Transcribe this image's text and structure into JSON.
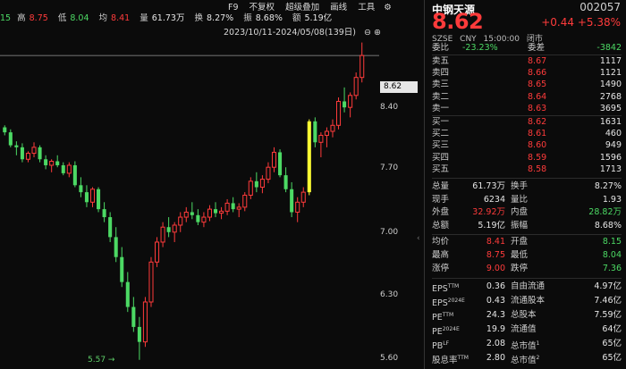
{
  "header": {
    "stats": [
      {
        "label": "15",
        "value": ""
      },
      {
        "label": "高",
        "value": "8.75"
      },
      {
        "label": "低",
        "value": "8.04"
      },
      {
        "label": "均",
        "value": "8.41"
      },
      {
        "label": "量",
        "value": "61.73万"
      },
      {
        "label": "换",
        "value": "8.27%"
      },
      {
        "label": "振",
        "value": "8.68%"
      },
      {
        "label": "额",
        "value": "5.19亿"
      }
    ],
    "menu": [
      "F9",
      "不复权",
      "超级叠加",
      "画线",
      "工具"
    ],
    "range": "2023/10/11-2024/05/08(139日)"
  },
  "chart": {
    "price_tag": "8.62",
    "low_label": "5.57",
    "y_ticks": [
      "8.40",
      "7.70",
      "7.00",
      "6.30",
      "5.60"
    ]
  },
  "chart_data": {
    "type": "candlestick",
    "y_range": [
      5.55,
      8.8
    ],
    "y_ticks": [
      8.4,
      7.7,
      7.0,
      6.3,
      5.6
    ],
    "candles": [
      [
        7.9,
        7.92,
        7.82,
        7.85
      ],
      [
        7.85,
        7.88,
        7.7,
        7.72
      ],
      [
        7.72,
        7.76,
        7.62,
        7.7
      ],
      [
        7.7,
        7.74,
        7.55,
        7.58
      ],
      [
        7.58,
        7.66,
        7.55,
        7.64
      ],
      [
        7.64,
        7.75,
        7.6,
        7.7
      ],
      [
        7.7,
        7.72,
        7.55,
        7.58
      ],
      [
        7.58,
        7.62,
        7.48,
        7.52
      ],
      [
        7.52,
        7.58,
        7.45,
        7.56
      ],
      [
        7.56,
        7.62,
        7.5,
        7.52
      ],
      [
        7.52,
        7.55,
        7.42,
        7.44
      ],
      [
        7.44,
        7.55,
        7.4,
        7.52
      ],
      [
        7.52,
        7.56,
        7.3,
        7.32
      ],
      [
        7.32,
        7.4,
        7.2,
        7.25
      ],
      [
        7.25,
        7.32,
        7.1,
        7.15
      ],
      [
        7.15,
        7.3,
        7.1,
        7.28
      ],
      [
        7.28,
        7.3,
        7.05,
        7.08
      ],
      [
        7.08,
        7.15,
        6.95,
        7.0
      ],
      [
        7.0,
        7.05,
        6.75,
        6.8
      ],
      [
        6.8,
        6.9,
        6.55,
        6.6
      ],
      [
        6.6,
        6.7,
        6.3,
        6.35
      ],
      [
        6.35,
        6.45,
        6.05,
        6.1
      ],
      [
        6.1,
        6.2,
        5.85,
        5.9
      ],
      [
        5.9,
        6.0,
        5.57,
        5.75
      ],
      [
        5.75,
        6.2,
        5.7,
        6.15
      ],
      [
        6.15,
        6.6,
        6.1,
        6.55
      ],
      [
        6.55,
        6.8,
        6.5,
        6.75
      ],
      [
        6.75,
        6.95,
        6.7,
        6.9
      ],
      [
        6.9,
        7.0,
        6.8,
        6.85
      ],
      [
        6.85,
        6.95,
        6.75,
        6.92
      ],
      [
        6.92,
        7.05,
        6.85,
        7.0
      ],
      [
        7.0,
        7.1,
        6.95,
        7.05
      ],
      [
        7.05,
        7.15,
        6.98,
        7.02
      ],
      [
        7.02,
        7.08,
        6.92,
        6.95
      ],
      [
        6.95,
        7.05,
        6.9,
        7.0
      ],
      [
        7.0,
        7.12,
        6.96,
        7.08
      ],
      [
        7.08,
        7.15,
        7.0,
        7.04
      ],
      [
        7.04,
        7.1,
        6.98,
        7.06
      ],
      [
        7.06,
        7.18,
        7.02,
        7.14
      ],
      [
        7.14,
        7.2,
        7.05,
        7.08
      ],
      [
        7.08,
        7.14,
        7.0,
        7.1
      ],
      [
        7.1,
        7.25,
        7.06,
        7.22
      ],
      [
        7.22,
        7.4,
        7.18,
        7.36
      ],
      [
        7.36,
        7.45,
        7.25,
        7.3
      ],
      [
        7.3,
        7.42,
        7.24,
        7.38
      ],
      [
        7.38,
        7.55,
        7.34,
        7.5
      ],
      [
        7.5,
        7.7,
        7.45,
        7.65
      ],
      [
        7.65,
        7.68,
        7.4,
        7.42
      ],
      [
        7.42,
        7.5,
        7.25,
        7.28
      ],
      [
        7.28,
        7.35,
        7.0,
        7.05
      ],
      [
        7.05,
        7.2,
        6.95,
        7.15
      ],
      [
        7.15,
        7.3,
        7.1,
        7.25
      ],
      [
        7.25,
        7.98,
        7.22,
        7.96
      ],
      [
        7.96,
        8.0,
        7.7,
        7.75
      ],
      [
        7.75,
        7.85,
        7.6,
        7.82
      ],
      [
        7.82,
        7.9,
        7.7,
        7.86
      ],
      [
        7.86,
        7.98,
        7.8,
        7.92
      ],
      [
        7.92,
        8.2,
        7.88,
        8.16
      ],
      [
        8.16,
        8.3,
        8.05,
        8.1
      ],
      [
        8.1,
        8.25,
        8.0,
        8.22
      ],
      [
        8.22,
        8.45,
        8.18,
        8.4
      ],
      [
        8.4,
        8.75,
        8.35,
        8.62
      ]
    ]
  },
  "quote": {
    "name": "中钢天源",
    "code": "002057",
    "price": "8.62",
    "change": "+0.44",
    "change_pct": "+5.38%",
    "exchange": "SZSE",
    "currency": "CNY",
    "time": "15:00:00",
    "status": "闭市",
    "ratio_label": "委比",
    "ratio_value": "-23.23%",
    "diff_label": "委差",
    "diff_value": "-3842"
  },
  "asks": [
    {
      "label": "卖五",
      "price": "8.67",
      "vol": "1117"
    },
    {
      "label": "卖四",
      "price": "8.66",
      "vol": "1121"
    },
    {
      "label": "卖三",
      "price": "8.65",
      "vol": "1490"
    },
    {
      "label": "卖二",
      "price": "8.64",
      "vol": "2768"
    },
    {
      "label": "卖一",
      "price": "8.63",
      "vol": "3695"
    }
  ],
  "bids": [
    {
      "label": "买一",
      "price": "8.62",
      "vol": "1631"
    },
    {
      "label": "买二",
      "price": "8.61",
      "vol": "460"
    },
    {
      "label": "买三",
      "price": "8.60",
      "vol": "949"
    },
    {
      "label": "买四",
      "price": "8.59",
      "vol": "1596"
    },
    {
      "label": "买五",
      "price": "8.58",
      "vol": "1713"
    }
  ],
  "stats_a": [
    {
      "l1": "总量",
      "v1": "61.73万",
      "c1": "white",
      "l2": "换手",
      "v2": "8.27%",
      "c2": "white"
    },
    {
      "l1": "现手",
      "v1": "6234",
      "c1": "white",
      "l2": "量比",
      "v2": "1.93",
      "c2": "white"
    },
    {
      "l1": "外盘",
      "v1": "32.92万",
      "c1": "red",
      "l2": "内盘",
      "v2": "28.82万",
      "c2": "green"
    },
    {
      "l1": "总额",
      "v1": "5.19亿",
      "c1": "white",
      "l2": "振幅",
      "v2": "8.68%",
      "c2": "white"
    }
  ],
  "stats_b": [
    {
      "l1": "均价",
      "v1": "8.41",
      "c1": "red",
      "l2": "开盘",
      "v2": "8.15",
      "c2": "green"
    },
    {
      "l1": "最高",
      "v1": "8.75",
      "c1": "red",
      "l2": "最低",
      "v2": "8.04",
      "c2": "green"
    },
    {
      "l1": "涨停",
      "v1": "9.00",
      "c1": "red",
      "l2": "跌停",
      "v2": "7.36",
      "c2": "green"
    }
  ],
  "stats_c": [
    {
      "l1": "EPS",
      "s1": "TTM",
      "v1": "0.36",
      "l2": "自由流通",
      "s2": "",
      "v2": "4.97亿"
    },
    {
      "l1": "EPS",
      "s1": "2024E",
      "v1": "0.43",
      "l2": "流通股本",
      "s2": "",
      "v2": "7.46亿"
    },
    {
      "l1": "PE",
      "s1": "TTM",
      "v1": "24.3",
      "l2": "总股本",
      "s2": "",
      "v2": "7.59亿"
    },
    {
      "l1": "PE",
      "s1": "2024E",
      "v1": "19.9",
      "l2": "流通值",
      "s2": "",
      "v2": "64亿"
    },
    {
      "l1": "PB",
      "s1": "LF",
      "v1": "2.08",
      "l2": "总市值",
      "s2": "1",
      "v2": "65亿"
    },
    {
      "l1": "股息率",
      "s1": "TTM",
      "v1": "2.80",
      "l2": "总市值",
      "s2": "2",
      "v2": "65亿"
    }
  ],
  "colors": {
    "up": "#ff3b3b",
    "down": "#4cd964",
    "bg": "#0b0b0b",
    "highlight": "#ffff33"
  }
}
